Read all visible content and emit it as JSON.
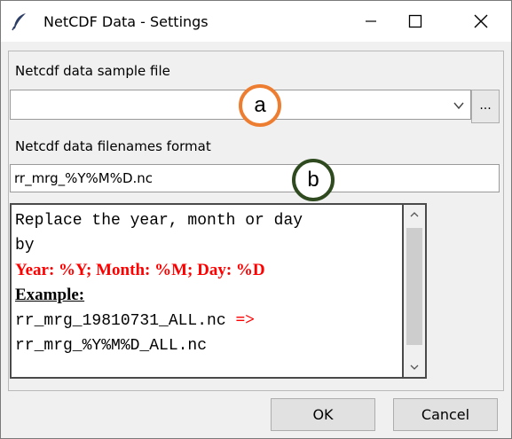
{
  "window": {
    "title": "NetCDF Data - Settings"
  },
  "form": {
    "sample_file_label": "Netcdf data sample file",
    "sample_file_value": "",
    "browse_label": "...",
    "filename_format_label": "Netcdf data filenames format",
    "filename_format_value": "rr_mrg_%Y%M%D.nc"
  },
  "help_text": {
    "line1": "Replace the year, month or day",
    "line2": "by",
    "line3": "Year: %Y; Month: %M; Day: %D",
    "line4": "Example:",
    "line5a": "rr_mrg_19810731_ALL.nc ",
    "line5b": "=>",
    "line6": "rr_mrg_%Y%M%D_ALL.nc"
  },
  "buttons": {
    "ok": "OK",
    "cancel": "Cancel"
  },
  "callouts": {
    "a": "a",
    "b": "b"
  },
  "colors": {
    "callout_a": "#ed7d31",
    "callout_b": "#2e4a1e",
    "help_red": "#ff0000"
  }
}
